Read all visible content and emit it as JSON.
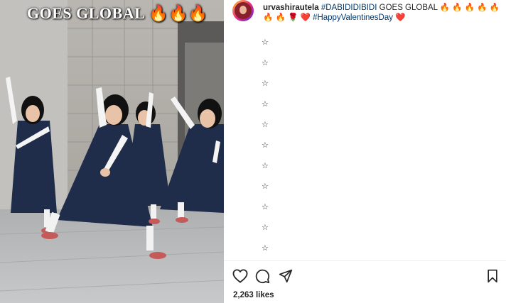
{
  "media": {
    "overlay_caption": "GOES GLOBAL 🔥🔥🔥"
  },
  "post": {
    "username": "urvashirautela",
    "caption_line1_tag": "#DABIDIDIBIDI",
    "caption_line1_rest": " GOES GLOBAL 🔥 🔥 🔥 🔥 🔥",
    "caption_line2_emojis": "🔥 🔥 🌹 ❤️ ",
    "caption_line2_tag": "#HappyValentinesDay",
    "caption_line2_end": " ❤️",
    "stars": [
      "☆",
      "☆",
      "☆",
      "☆",
      "☆",
      "☆",
      "☆",
      "☆",
      "☆",
      "☆",
      "☆"
    ]
  },
  "actions": {
    "like_icon": "heart-outline-icon",
    "comment_icon": "comment-bubble-icon",
    "share_icon": "paper-plane-icon",
    "save_icon": "bookmark-icon"
  },
  "likes": "2,263 likes",
  "colors": {
    "hashtag": "#00376b",
    "text": "#262626"
  }
}
